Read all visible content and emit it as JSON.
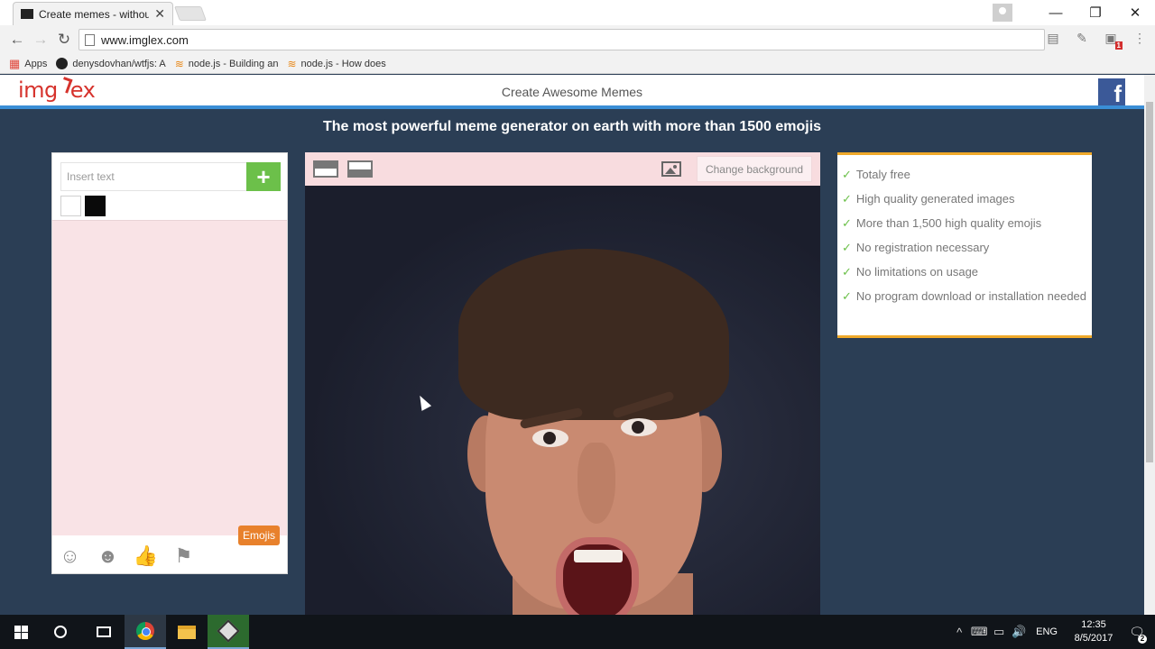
{
  "browser": {
    "tab_title": "Create memes - without",
    "tab_close": "✕",
    "window_controls": {
      "minimize": "—",
      "maximize": "❐",
      "close": "✕"
    },
    "nav": {
      "back": "←",
      "forward": "→",
      "reload": "↻"
    },
    "url": "www.imglex.com",
    "toolbar_icons": {
      "reader": "▤",
      "eyedropper": "✎",
      "extension_badge": "1",
      "menu": "⋮"
    },
    "bookmarks": [
      {
        "label": "Apps",
        "icon": "apps-grid-icon"
      },
      {
        "label": "denysdovhan/wtfjs: A",
        "icon": "github-icon"
      },
      {
        "label": "node.js - Building an",
        "icon": "stackoverflow-icon"
      },
      {
        "label": "node.js - How does",
        "icon": "stackoverflow-icon"
      }
    ]
  },
  "site": {
    "logo_left": "img",
    "logo_right": "ex",
    "header_title": "Create Awesome Memes",
    "facebook_letter": "f",
    "headline": "The most powerful meme generator on earth with more than 1500 emojis"
  },
  "editor": {
    "text_placeholder": "Insert text",
    "add_symbol": "+",
    "colors": {
      "white": "#ffffff",
      "black": "#0a0a0a"
    },
    "emojis_button": "Emojis",
    "emoji_tabs": [
      "☺",
      "☻",
      "👍",
      "⚑"
    ],
    "change_background": "Change background"
  },
  "features": [
    "Totaly free",
    "High quality generated images",
    "More than 1,500 high quality emojis",
    "No registration necessary",
    "No limitations on usage",
    "No program download or installation needed"
  ],
  "taskbar": {
    "tray_icons": [
      "^",
      "⌨",
      "▭",
      "🔊"
    ],
    "language": "ENG",
    "time": "12:35",
    "date": "8/5/2017",
    "notification_count": "2",
    "notification_symbol": "🗨"
  },
  "colors": {
    "accent_green": "#6cc04a",
    "emoji_orange": "#e8812c",
    "header_blue": "#3a8ed6",
    "feature_border": "#f0a92a",
    "facebook": "#3b5998"
  }
}
